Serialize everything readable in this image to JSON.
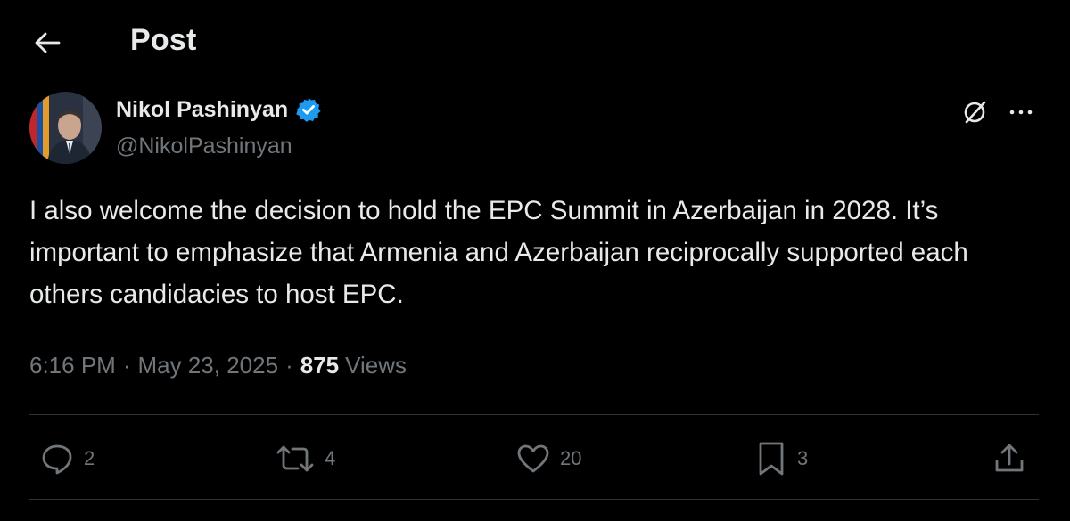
{
  "header": {
    "title": "Post",
    "back_icon": "arrow-left-icon"
  },
  "post": {
    "author": {
      "name": "Nikol Pashinyan",
      "handle": "@NikolPashinyan",
      "verified_icon": "verified-badge-icon",
      "verified_color": "#1d9bf0"
    },
    "text": "I also welcome the decision to hold the EPC Summit in Azerbaijan in 2028. It’s important to emphasize that Armenia and Azerbaijan reciprocally supported each others candidacies to host EPC.",
    "time": "6:16 PM",
    "date": "May 23, 2025",
    "separator": "·",
    "views_count": "875",
    "views_label": "Views"
  },
  "actions": {
    "replies": "2",
    "reposts": "4",
    "likes": "20",
    "bookmarks": "3"
  },
  "colors": {
    "background": "#000000",
    "text_primary": "#e7e9ea",
    "text_secondary": "#71767b",
    "divider": "#2f3336",
    "accent": "#1d9bf0"
  }
}
